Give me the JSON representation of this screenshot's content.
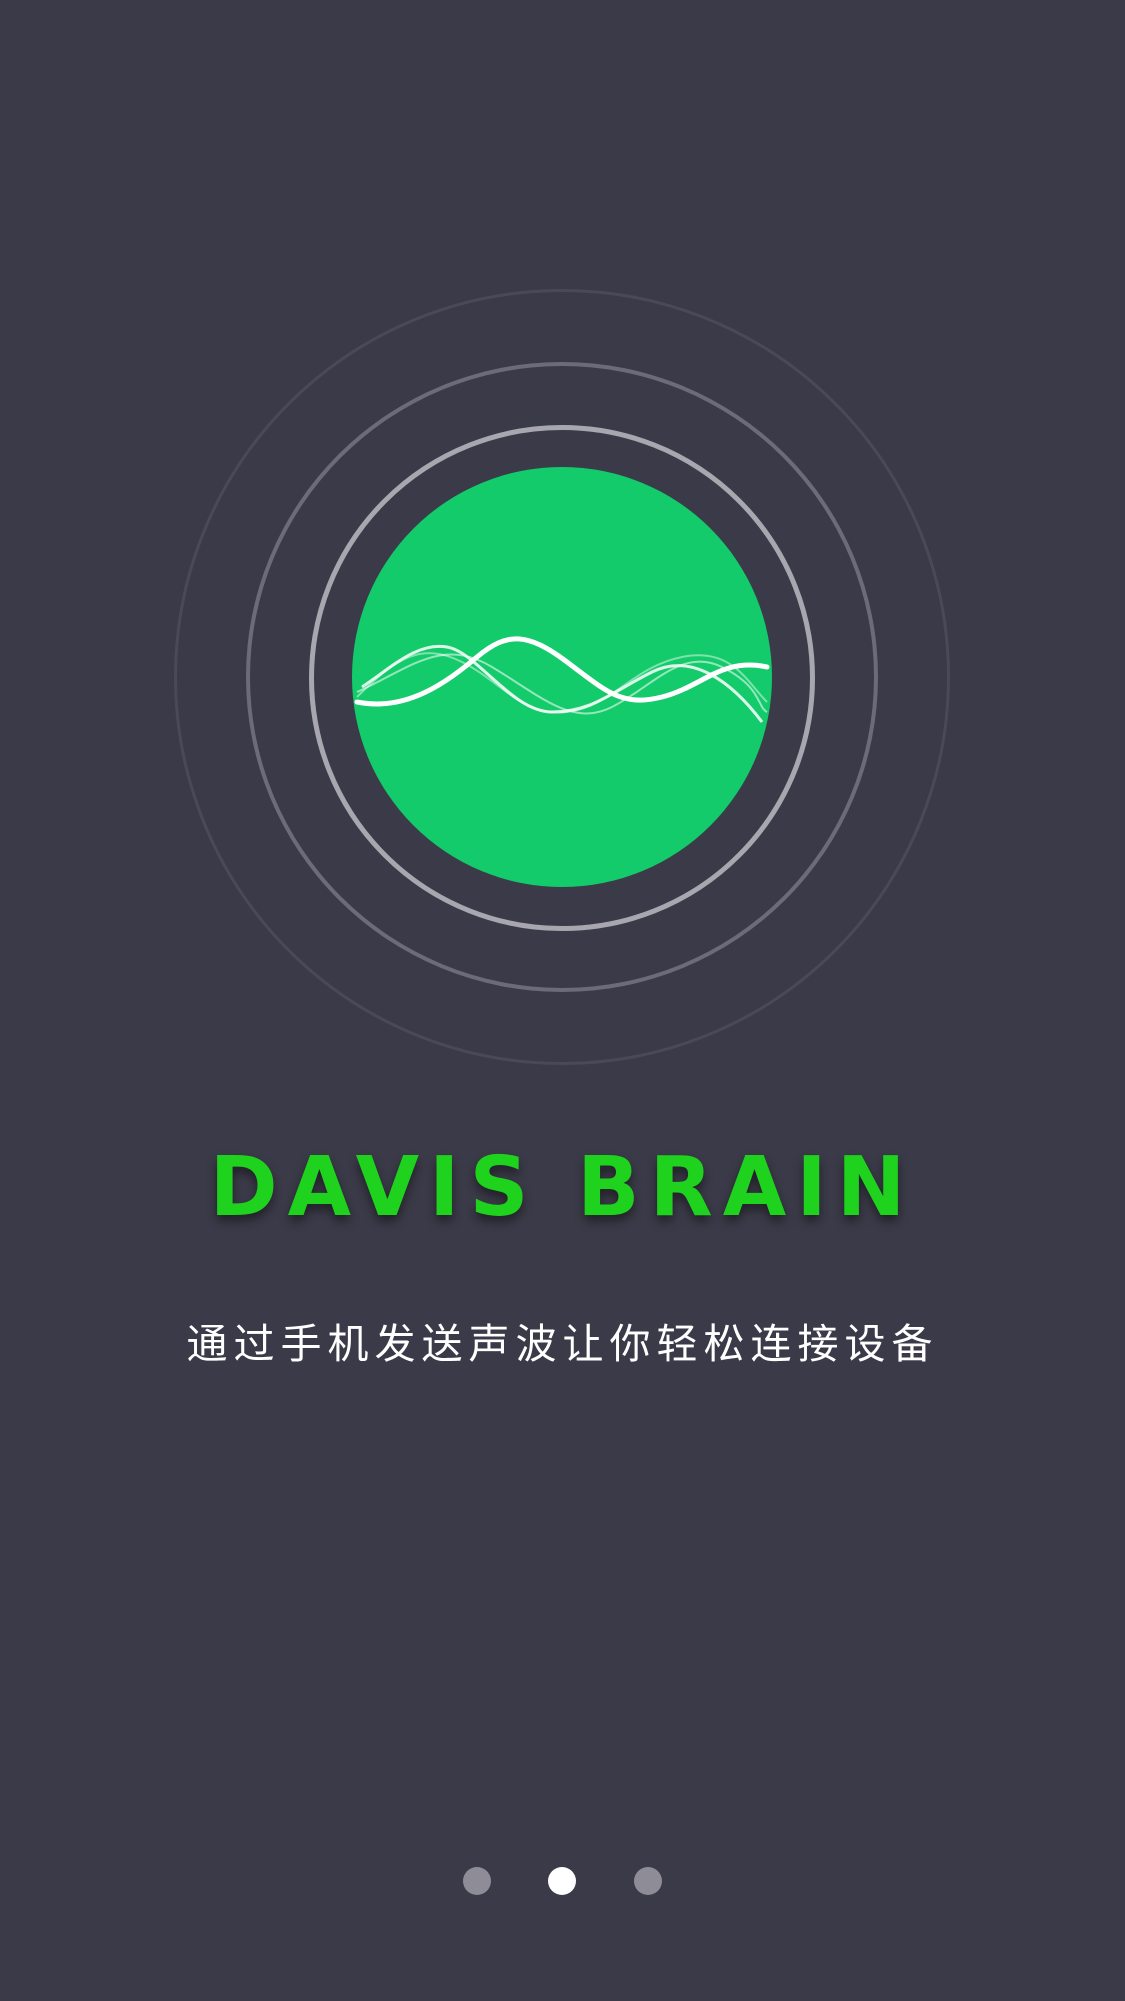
{
  "app": {
    "brand_name": "DAVIS BRAIN",
    "tagline": "通过手机发送声波让你轻松连接设备"
  },
  "colors": {
    "background": "#3b3a48",
    "core_circle": "#13cb6b",
    "brand_text": "#1ed21e",
    "tagline_text": "#ffffff",
    "dot_active": "#ffffff",
    "dot_inactive": "#8e8d97"
  },
  "illustration": {
    "icon": "sound-wave-icon"
  },
  "pager": {
    "total_pages": 3,
    "current_page": 2
  }
}
